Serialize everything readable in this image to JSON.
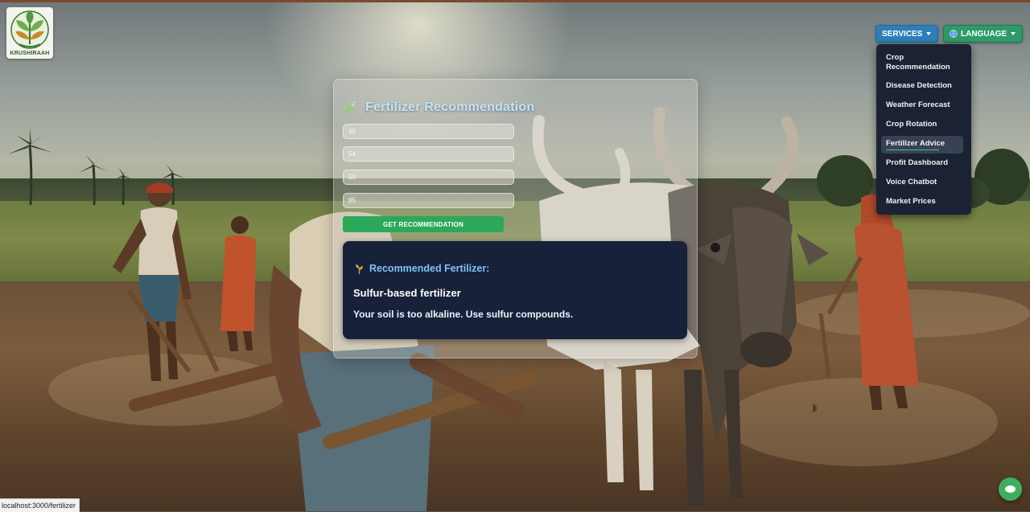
{
  "brand": {
    "logo_text": "KRUSHIRAAH"
  },
  "nav": {
    "services_label": "SERVICES",
    "language_label": "LANGUAGE",
    "services_menu": [
      {
        "label": "Crop Recommendation",
        "active": false
      },
      {
        "label": "Disease Detection",
        "active": false
      },
      {
        "label": "Weather Forecast",
        "active": false
      },
      {
        "label": "Crop Rotation",
        "active": false
      },
      {
        "label": "Fertilizer Advice",
        "active": true
      },
      {
        "label": "Profit Dashboard",
        "active": false
      },
      {
        "label": "Voice Chatbot",
        "active": false
      },
      {
        "label": "Market Prices",
        "active": false
      }
    ]
  },
  "form": {
    "title": "Fertilizer Recommendation",
    "title_icon": "syringe-icon",
    "inputs": [
      "45",
      "54",
      "50",
      "85"
    ],
    "submit_label": "GET RECOMMENDATION"
  },
  "result": {
    "heading": "Recommended Fertilizer:",
    "heading_icon": "sprout-icon",
    "name": "Sulfur-based fertilizer",
    "description": "Your soil is too alkaline. Use sulfur compounds."
  },
  "status_bar": {
    "url": "localhost:3000/fertilizer"
  },
  "chat": {
    "icon": "chat-bubble-icon"
  },
  "colors": {
    "services_btn": "#2c7fb8",
    "language_btn": "#2e9a6a",
    "submit_btn": "#2ca85a",
    "title": "#bfe6ff",
    "result_panel": "#18213a",
    "result_heading": "#7fc3f5",
    "menu_bg": "#1b2233",
    "active_underline": "#3ec27a"
  }
}
